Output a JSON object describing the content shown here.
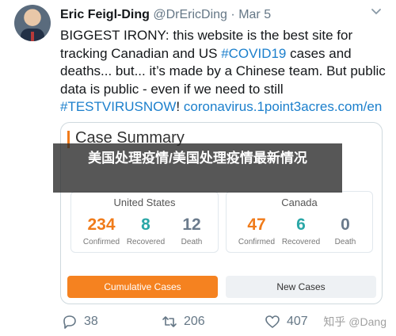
{
  "author": {
    "name": "Eric Feigl-Ding",
    "handle": "@DrEricDing",
    "separator": "·",
    "date": "Mar 5"
  },
  "tweet": {
    "line1": "BIGGEST IRONY: this website is the best site for",
    "line2_a": "tracking Canadian and US ",
    "line2_tag": "#COVID19",
    "line2_b": " cases and",
    "line3": "deaths... but... it’s made by a Chinese team. But public",
    "line4": "data is public - even if we need to still",
    "line5_tag": "#TESTVIRUSNOW",
    "line5_bang": "!",
    "line5_link": "coronavirus.1point3acres.com/en"
  },
  "card": {
    "title": "Case Summary",
    "us": {
      "title": "United States",
      "confirmed": "234",
      "recovered": "8",
      "death": "12"
    },
    "canada": {
      "title": "Canada",
      "confirmed": "47",
      "recovered": "6",
      "death": "0"
    },
    "labels": {
      "confirmed": "Confirmed",
      "recovered": "Recovered",
      "death": "Death"
    },
    "buttons": {
      "cumulative": "Cumulative Cases",
      "new": "New Cases"
    }
  },
  "actions": {
    "replies": "38",
    "retweets": "206",
    "likes": "407"
  },
  "overlay": {
    "text": "美国处理疫情/美国处理疫情最新情况"
  },
  "watermark": "知乎 @Dang",
  "colors": {
    "accent": "#f58220",
    "link": "#1b7fcc",
    "teal": "#2aa7a7"
  },
  "icons": {
    "reply": "reply-icon",
    "retweet": "retweet-icon",
    "like": "heart-icon",
    "menu": "chevron-down-icon"
  }
}
